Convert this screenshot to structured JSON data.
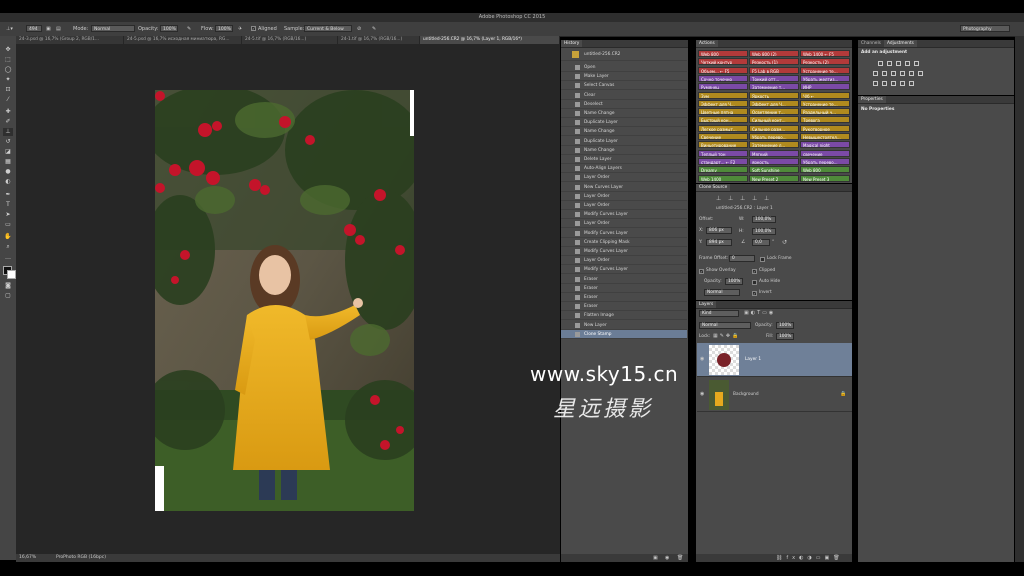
{
  "window": {
    "title": "Adobe Photoshop CC 2015"
  },
  "options_bar": {
    "brush_size": "494",
    "mode_label": "Mode:",
    "mode_value": "Normal",
    "opacity_label": "Opacity:",
    "opacity_value": "100%",
    "flow_label": "Flow:",
    "flow_value": "100%",
    "aligned_label": "Aligned",
    "sample_label": "Sample:",
    "sample_value": "Current & Below",
    "workspace": "Photography"
  },
  "doc_tabs": [
    {
      "label": "24-3.psd @ 16,7% (Group 2, RGB/1..."
    },
    {
      "label": "24-5.psd @ 16,7% исходная миниатюра, RG..."
    },
    {
      "label": "24-5.tif @ 16,7% (RGB/16...)"
    },
    {
      "label": "24-1.tif @ 16,7% (RGB/16...)"
    },
    {
      "label": "untitled-256.CR2 @ 16,7% (Layer 1, RGB/16*)"
    }
  ],
  "status": {
    "zoom": "16,67%",
    "profile": "ProPhoto RGB (16bpc)"
  },
  "history": {
    "tab": "History",
    "snapshot": "untitled-256.CR2",
    "items": [
      "Open",
      "Make Layer",
      "Select Canvas",
      "Clear",
      "Deselect",
      "Name Change",
      "Duplicate Layer",
      "Name Change",
      "Duplicate Layer",
      "Name Change",
      "Delete Layer",
      "Auto-Align Layers",
      "Layer Order",
      "New Curves Layer",
      "Layer Order",
      "Layer Order",
      "Modify Curves Layer",
      "Layer Order",
      "Modify Curves Layer",
      "Create Clipping Mask",
      "Modify Curves Layer",
      "Layer Order",
      "Modify Curves Layer",
      "Eraser",
      "Eraser",
      "Eraser",
      "Eraser",
      "Flatten Image",
      "New Layer",
      "Clone Stamp"
    ]
  },
  "actions": {
    "tab": "Actions",
    "buttons": [
      {
        "label": "Web 800",
        "color": "#b23a3a"
      },
      {
        "label": "Web 800 (2)",
        "color": "#b23a3a"
      },
      {
        "label": "Web 1400 ← F5",
        "color": "#b23a3a"
      },
      {
        "label": "Четкий контур",
        "color": "#b23a3a"
      },
      {
        "label": "Резкость (1)",
        "color": "#b23a3a"
      },
      {
        "label": "Резкость (2)",
        "color": "#b23a3a"
      },
      {
        "label": "Объем... ← F5",
        "color": "#b23a3a"
      },
      {
        "label": "F5 Lab в RGB",
        "color": "#b23a3a"
      },
      {
        "label": "Устранение те...",
        "color": "#b23a3a"
      },
      {
        "label": "Сочно точечно",
        "color": "#7b4aa6"
      },
      {
        "label": "Тонкий отт...",
        "color": "#7b4aa6"
      },
      {
        "label": "Убрать желтиз...",
        "color": "#7b4aa6"
      },
      {
        "label": "Румянец",
        "color": "#7b4aa6"
      },
      {
        "label": "Затемнение т...",
        "color": "#7b4aa6"
      },
      {
        "label": "ИНР",
        "color": "#7b4aa6"
      },
      {
        "label": "Зум",
        "color": "#b08a1e"
      },
      {
        "label": "Яркость",
        "color": "#b08a1e"
      },
      {
        "label": "Ч/б ←",
        "color": "#b08a1e"
      },
      {
        "label": "Эффект для Ч...",
        "color": "#b08a1e"
      },
      {
        "label": "Эффект для Ч...",
        "color": "#b08a1e"
      },
      {
        "label": "Устранение те...",
        "color": "#b08a1e"
      },
      {
        "label": "Цветные пятна",
        "color": "#b08a1e"
      },
      {
        "label": "Осветление т...",
        "color": "#b08a1e"
      },
      {
        "label": "Раздельный ч...",
        "color": "#b08a1e"
      },
      {
        "label": "Быстрый кон...",
        "color": "#b08a1e"
      },
      {
        "label": "Сильный конт...",
        "color": "#b08a1e"
      },
      {
        "label": "Тревога",
        "color": "#b08a1e"
      },
      {
        "label": "Легкое размыт...",
        "color": "#b08a1e"
      },
      {
        "label": "Сильное разм...",
        "color": "#b08a1e"
      },
      {
        "label": "Рукотворное",
        "color": "#b08a1e"
      },
      {
        "label": "Свечение",
        "color": "#b08a1e"
      },
      {
        "label": "Убрать перево...",
        "color": "#b08a1e"
      },
      {
        "label": "Невышестоятел...",
        "color": "#b08a1e"
      },
      {
        "label": "Виньетирование",
        "color": "#b08a1e"
      },
      {
        "label": "Затемнение л...",
        "color": "#b08a1e"
      },
      {
        "label": "Magical night",
        "color": "#7b4aa6"
      },
      {
        "label": "Теплый тон",
        "color": "#7b4aa6"
      },
      {
        "label": "Мягкий",
        "color": "#7b4aa6"
      },
      {
        "label": "свечение",
        "color": "#7b4aa6"
      },
      {
        "label": "стандарт... ← F2",
        "color": "#7b4aa6"
      },
      {
        "label": "яркость",
        "color": "#7b4aa6"
      },
      {
        "label": "Убрать перево...",
        "color": "#7b4aa6"
      },
      {
        "label": "Dreamy",
        "color": "#4f8a3a"
      },
      {
        "label": "Soft Sunshine",
        "color": "#4f8a3a"
      },
      {
        "label": "Web 800",
        "color": "#4f8a3a"
      },
      {
        "label": "Web 1400",
        "color": "#4f8a3a"
      },
      {
        "label": "New Preset 2",
        "color": "#4f8a3a"
      },
      {
        "label": "New Preset 3",
        "color": "#4f8a3a"
      }
    ]
  },
  "clone_source": {
    "tab": "Clone Source",
    "source": "untitled-256.CR2 : Layer 1",
    "offset_label": "Offset:",
    "x_label": "X:",
    "x_value": "806 px",
    "y_label": "Y:",
    "y_value": "894 px",
    "w_label": "W:",
    "w_value": "100,0%",
    "h_label": "H:",
    "h_value": "100,0%",
    "angle_value": "0,0",
    "angle_unit": "°",
    "frame_offset_label": "Frame Offset:",
    "frame_offset_value": "0",
    "lock_frame": "Lock Frame",
    "show_overlay": "Show Overlay",
    "clipped": "Clipped",
    "opacity_label": "Opacity:",
    "opacity_value": "100%",
    "auto_hide": "Auto Hide",
    "blend": "Normal",
    "invert": "Invert"
  },
  "layers": {
    "tab": "Layers",
    "filter": "Kind",
    "blend": "Normal",
    "opacity_label": "Opacity:",
    "opacity_value": "100%",
    "lock_label": "Lock:",
    "fill_label": "Fill:",
    "fill_value": "100%",
    "items": [
      {
        "name": "Layer 1"
      },
      {
        "name": "Background"
      }
    ]
  },
  "channels": {
    "tab1": "Channels",
    "tab2": "Adjustments",
    "add": "Add an adjustment"
  },
  "properties": {
    "tab": "Properties",
    "empty": "No Properties"
  },
  "watermark": {
    "url": "www.sky15.cn",
    "cn": "星远摄影"
  }
}
